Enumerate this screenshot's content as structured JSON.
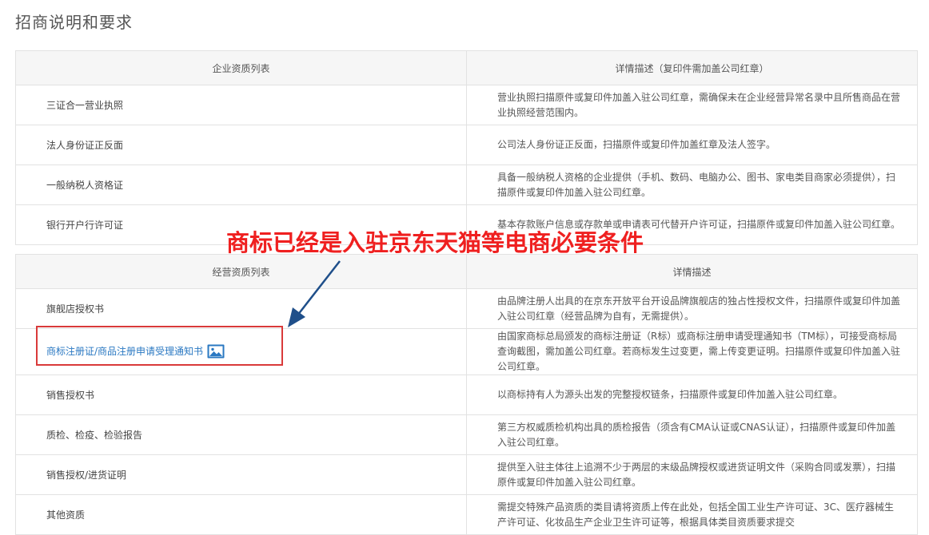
{
  "page": {
    "title": "招商说明和要求"
  },
  "table1": {
    "headers": [
      "企业资质列表",
      "详情描述（复印件需加盖公司红章）"
    ],
    "rows": [
      {
        "name": "三证合一营业执照",
        "desc": "营业执照扫描原件或复印件加盖入驻公司红章，需确保未在企业经营异常名录中且所售商品在营业执照经营范围内。"
      },
      {
        "name": "法人身份证正反面",
        "desc": "公司法人身份证正反面，扫描原件或复印件加盖红章及法人签字。"
      },
      {
        "name": "一般纳税人资格证",
        "desc": "具备一般纳税人资格的企业提供（手机、数码、电脑办公、图书、家电类目商家必须提供），扫描原件或复印件加盖入驻公司红章。"
      },
      {
        "name": "银行开户行许可证",
        "desc": "基本存款账户信息或存款单或申请表可代替开户许可证，扫描原件或复印件加盖入驻公司红章。"
      }
    ]
  },
  "table2": {
    "headers": [
      "经营资质列表",
      "详情描述"
    ],
    "rows": [
      {
        "name": "旗舰店授权书",
        "desc": "由品牌注册人出具的在京东开放平台开设品牌旗舰店的独占性授权文件，扫描原件或复印件加盖入驻公司红章（经营品牌为自有，无需提供）。"
      },
      {
        "name": "商标注册证/商品注册申请受理通知书",
        "desc": "由国家商标总局颁发的商标注册证（R标）或商标注册申请受理通知书（TM标），可接受商标局查询截图，需加盖公司红章。若商标发生过变更，需上传变更证明。扫描原件或复印件加盖入驻公司红章。"
      },
      {
        "name": "销售授权书",
        "desc": "以商标持有人为源头出发的完整授权链条，扫描原件或复印件加盖入驻公司红章。"
      },
      {
        "name": "质检、检疫、检验报告",
        "desc": "第三方权威质检机构出具的质检报告（须含有CMA认证或CNAS认证），扫描原件或复印件加盖入驻公司红章。"
      },
      {
        "name": "销售授权/进货证明",
        "desc": "提供至入驻主体往上追溯不少于两层的末级品牌授权或进货证明文件（采购合同或发票），扫描原件或复印件加盖入驻公司红章。"
      },
      {
        "name": "其他资质",
        "desc": "需提交特殊产品资质的类目请将资质上传在此处，包括全国工业生产许可证、3C、医疗器械生产许可证、化妆品生产企业卫生许可证等，根据具体类目资质要求提交"
      }
    ]
  },
  "annotation": {
    "text": "商标已经是入驻京东天猫等电商必要条件",
    "color": "#ef2020"
  },
  "icons": {
    "image_icon": "image-icon"
  },
  "colors": {
    "link": "#2a78c2",
    "header_bg": "#f6f6f6",
    "border": "#e2e2e2",
    "annotation": "#ef2020"
  }
}
